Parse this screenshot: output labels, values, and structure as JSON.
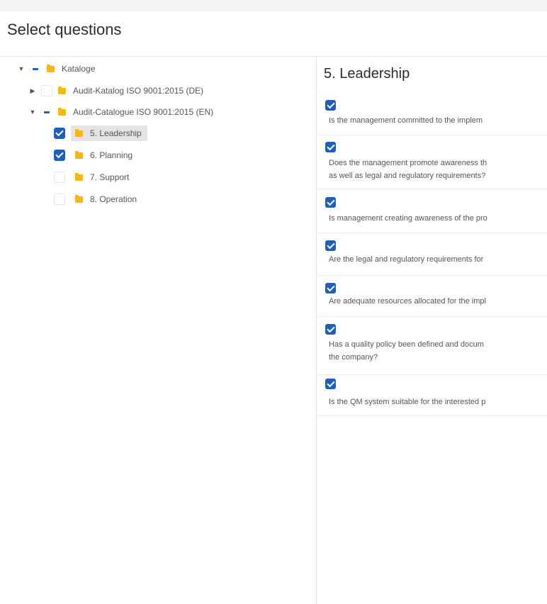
{
  "header": {
    "title": "Select questions"
  },
  "tree": {
    "root": {
      "label": "Kataloge"
    },
    "catalog_de": {
      "label": "Audit-Katalog ISO 9001:2015 (DE)"
    },
    "catalog_en": {
      "label": "Audit-Catalogue ISO 9001:2015 (EN)"
    },
    "children": [
      {
        "label": "5. Leadership",
        "checked": true,
        "selected": true
      },
      {
        "label": "6. Planning",
        "checked": true,
        "selected": false
      },
      {
        "label": "7. Support",
        "checked": false,
        "selected": false
      },
      {
        "label": "8. Operation",
        "checked": false,
        "selected": false
      }
    ]
  },
  "main": {
    "section_title": "5. Leadership",
    "questions": [
      {
        "line1": "Is the management committed to the implem",
        "line2": "",
        "checked": true
      },
      {
        "line1": "Does the management promote awareness th",
        "line2": "as well as legal and regulatory requirements?",
        "checked": true
      },
      {
        "line1": "Is management creating awareness of the pro",
        "line2": "",
        "checked": true
      },
      {
        "line1": "Are the legal and regulatory requirements for",
        "line2": "",
        "checked": true
      },
      {
        "line1": "Are adequate resources allocated for the impl",
        "line2": "",
        "checked": true
      },
      {
        "line1": "Has a quality policy been defined and docum",
        "line2": "the company?",
        "checked": true
      },
      {
        "line1": "Is the QM system suitable for the interested p",
        "line2": "",
        "checked": true
      }
    ]
  },
  "colors": {
    "accent": "#1d5fbf",
    "folder": "#f2b81c",
    "selected_bg": "#e4e4e4"
  }
}
